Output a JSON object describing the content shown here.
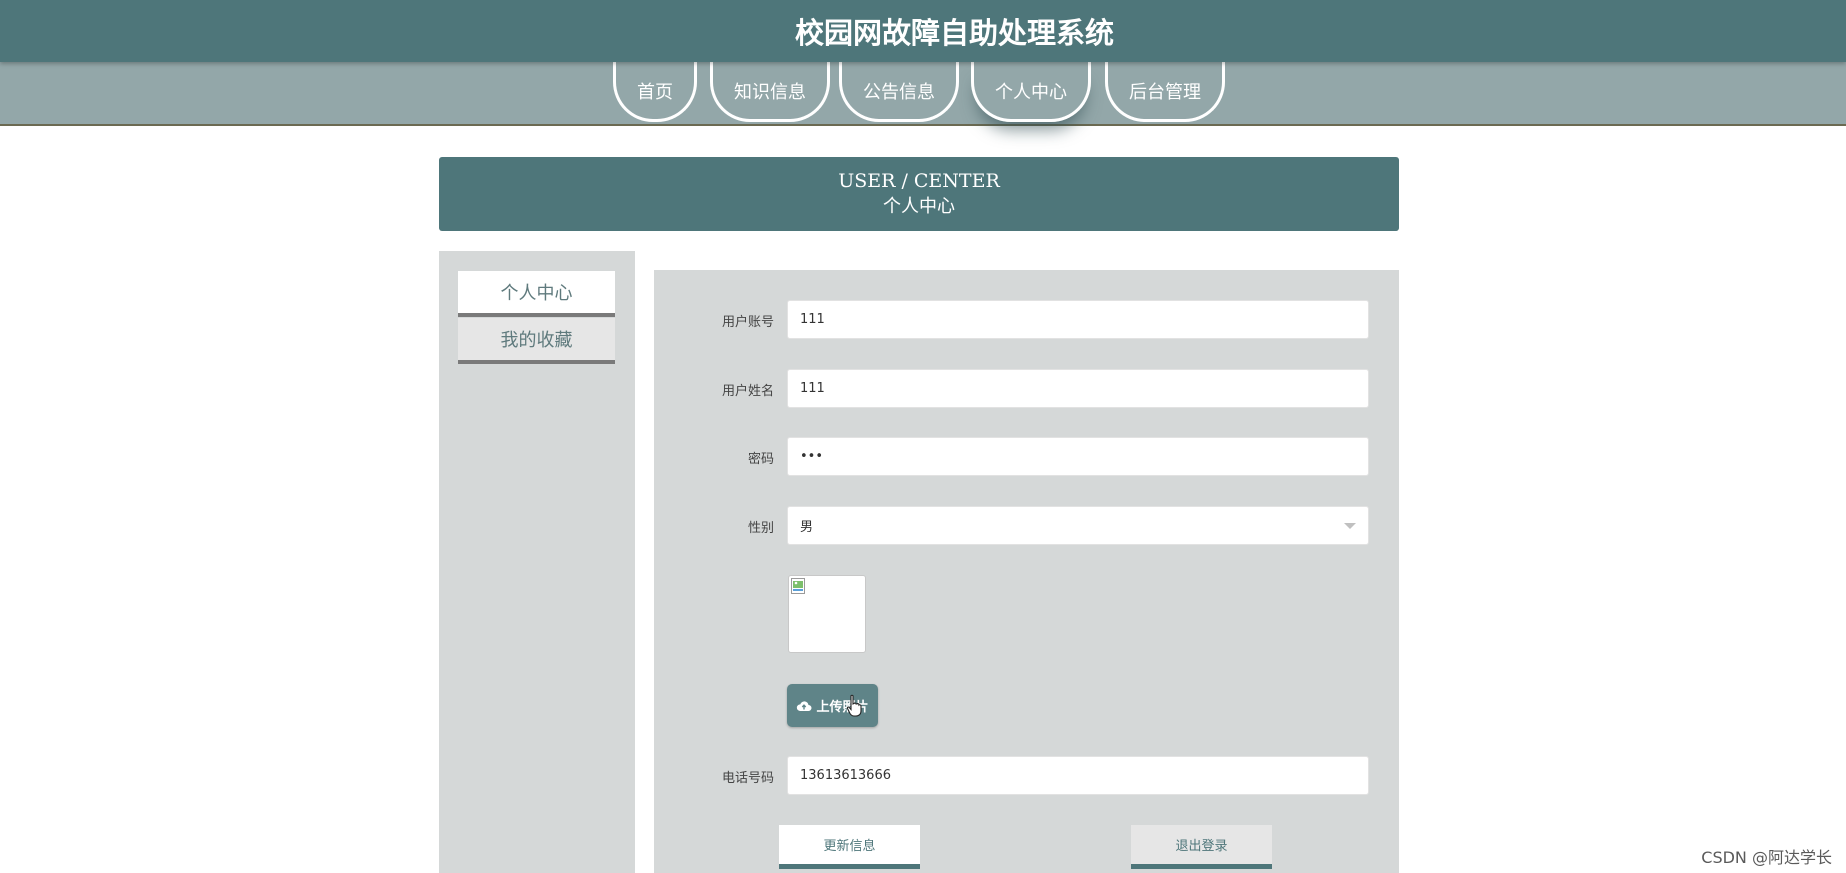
{
  "header": {
    "title": "校园网故障自助处理系统"
  },
  "nav": {
    "items": [
      {
        "label": "首页"
      },
      {
        "label": "知识信息"
      },
      {
        "label": "公告信息"
      },
      {
        "label": "个人中心",
        "active": true
      },
      {
        "label": "后台管理"
      }
    ]
  },
  "banner": {
    "english": "USER / CENTER",
    "chinese": "个人中心"
  },
  "sidebar": {
    "items": [
      {
        "label": "个人中心",
        "active": true
      },
      {
        "label": "我的收藏"
      }
    ]
  },
  "form": {
    "username_label": "用户账号",
    "username_value": "111",
    "name_label": "用户姓名",
    "name_value": "111",
    "password_label": "密码",
    "password_value": "•••",
    "gender_label": "性别",
    "gender_value": "男",
    "upload_label": "上传照片",
    "phone_label": "电话号码",
    "phone_value": "13613613666",
    "update_button": "更新信息",
    "logout_button": "退出登录"
  },
  "watermark": "CSDN @阿达学长",
  "colors": {
    "primary": "#4e767a",
    "nav_bg": "#93a7a9",
    "panel_bg": "#d5d8d8",
    "upload_button": "#5f8488"
  },
  "icons": {
    "upload": "cloud-upload-icon",
    "select": "chevron-down-icon",
    "avatar_placeholder": "broken-image-icon",
    "pointer": "mouse-cursor-icon"
  }
}
